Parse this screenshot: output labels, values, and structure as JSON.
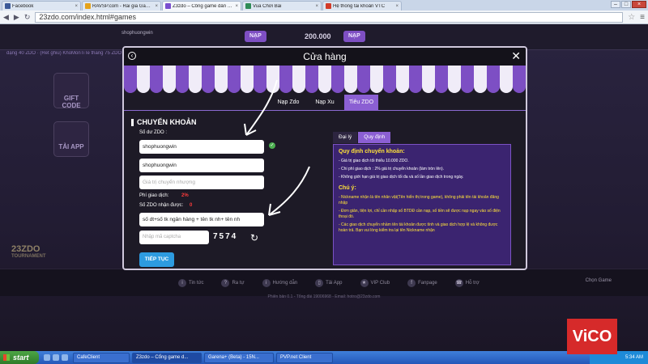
{
  "browser": {
    "tabs": [
      {
        "label": "Facebook",
        "color": "#3b5998",
        "active": false
      },
      {
        "label": "RAVSP.com - Rai gia Game Lo",
        "color": "#e5a21a",
        "active": false
      },
      {
        "label": "Z3zdo – Cổng game dân giam",
        "color": "#7a4fcf",
        "active": true
      },
      {
        "label": "Vua Chơi Bài",
        "color": "#2e8b57",
        "active": false
      },
      {
        "label": "Hệ thống tài khoản VTC",
        "color": "#d23b2a",
        "active": false
      }
    ],
    "url": "23zdo.com/index.html#games"
  },
  "game": {
    "username": "shophuongwin",
    "balance": "200.000",
    "nap_label": "NẠP",
    "ticker": "đặng 40 ZDO · (Ret ghiu) KhoMonTiTe thắng 75 ZDO · (Ret ghiu) ...  · nguyenha thắng 201 ZDO",
    "left_boxes": [
      "GIFT CODE",
      "TẢI APP"
    ],
    "tournament_title": "23ZDO",
    "tournament_sub": "TOURNAMENT",
    "footer": [
      {
        "icon": "i",
        "label": "Tin tức"
      },
      {
        "icon": "?",
        "label": "Ra tự"
      },
      {
        "icon": "i",
        "label": "Hướng dẫn"
      },
      {
        "icon": "▯",
        "label": "Tải App"
      },
      {
        "icon": "★",
        "label": "VIP Club"
      },
      {
        "icon": "f",
        "label": "Fanpage"
      },
      {
        "icon": "☎",
        "label": "Hỗ trợ"
      }
    ],
    "chon_game": "Chọn Game",
    "copyright": "Phiên bản 0.1 - Tổng đài 19006968 - Email: hotro@23zdo.com"
  },
  "modal": {
    "title": "Cửa hàng",
    "tabs": [
      "Nạp Zdo",
      "Nạp Xu",
      "Tiêu ZDO"
    ],
    "active_tab": 2,
    "section_title": "CHUYỂN KHOẢN",
    "balance_label": "Số dư ZDO :",
    "balance_value": "shophuongwin",
    "receiver_value": "shophuongwin",
    "amount_placeholder": "Giá trị chuyển nhượng",
    "fee_label": "Phí giao dịch:",
    "fee_value": "2%",
    "receive_label": "Số ZDO nhận được:",
    "receive_value": "0",
    "note_value": "số dt+số tk ngân hàng + tên tk nh+ tên nh",
    "captcha_placeholder": "Nhập mã captcha",
    "captcha_text": "7574",
    "submit_label": "TIẾP TỤC",
    "right_tabs": [
      "Đại lý",
      "Quy định"
    ],
    "right_active": 1,
    "rules_title": "Quy định chuyển khoản:",
    "rules": [
      "- Giá trị giao dịch tối thiểu 10.000 ZDO.",
      "- Chi phí giao dịch : 2% giá trị chuyển khoản (làm tròn lên).",
      "- Không giới hạn giá trị giao dịch tối đa và số lần giao dịch trong ngày."
    ],
    "notes_title": "Chú ý:",
    "notes": [
      "- Nickname nhận là tên nhân vật(Tên hiển thị trong game), không phải tên tài khoản đăng nhập",
      "- Đơn giản, tiện lợi, chỉ cần nhập số BTDĐ cần nạp, số tiền sẽ được nạp ngay vào số điện thoại đó.",
      "- Các giao dịch chuyển nhầm tên tài khoản được tính và giao dịch hợp lệ và không được hoàn trả. Bạn vui lòng kiểm tra lại tên Nickname nhận"
    ]
  },
  "taskbar": {
    "start_label": "start",
    "items": [
      "CafeClient",
      "Z3zdo – Cổng game d...",
      "Garena+ (Beta) - 15N...",
      "PVP.net Client"
    ],
    "active_item": 1,
    "clock": "5:34 AM"
  },
  "watermark": "VICO",
  "colors": {
    "accent": "#8b5fd3",
    "rules_bg": "#3b2470",
    "highlight": "#ffe23a",
    "fee_red": "#ff3b3b",
    "submit_blue": "#2d9be0"
  }
}
